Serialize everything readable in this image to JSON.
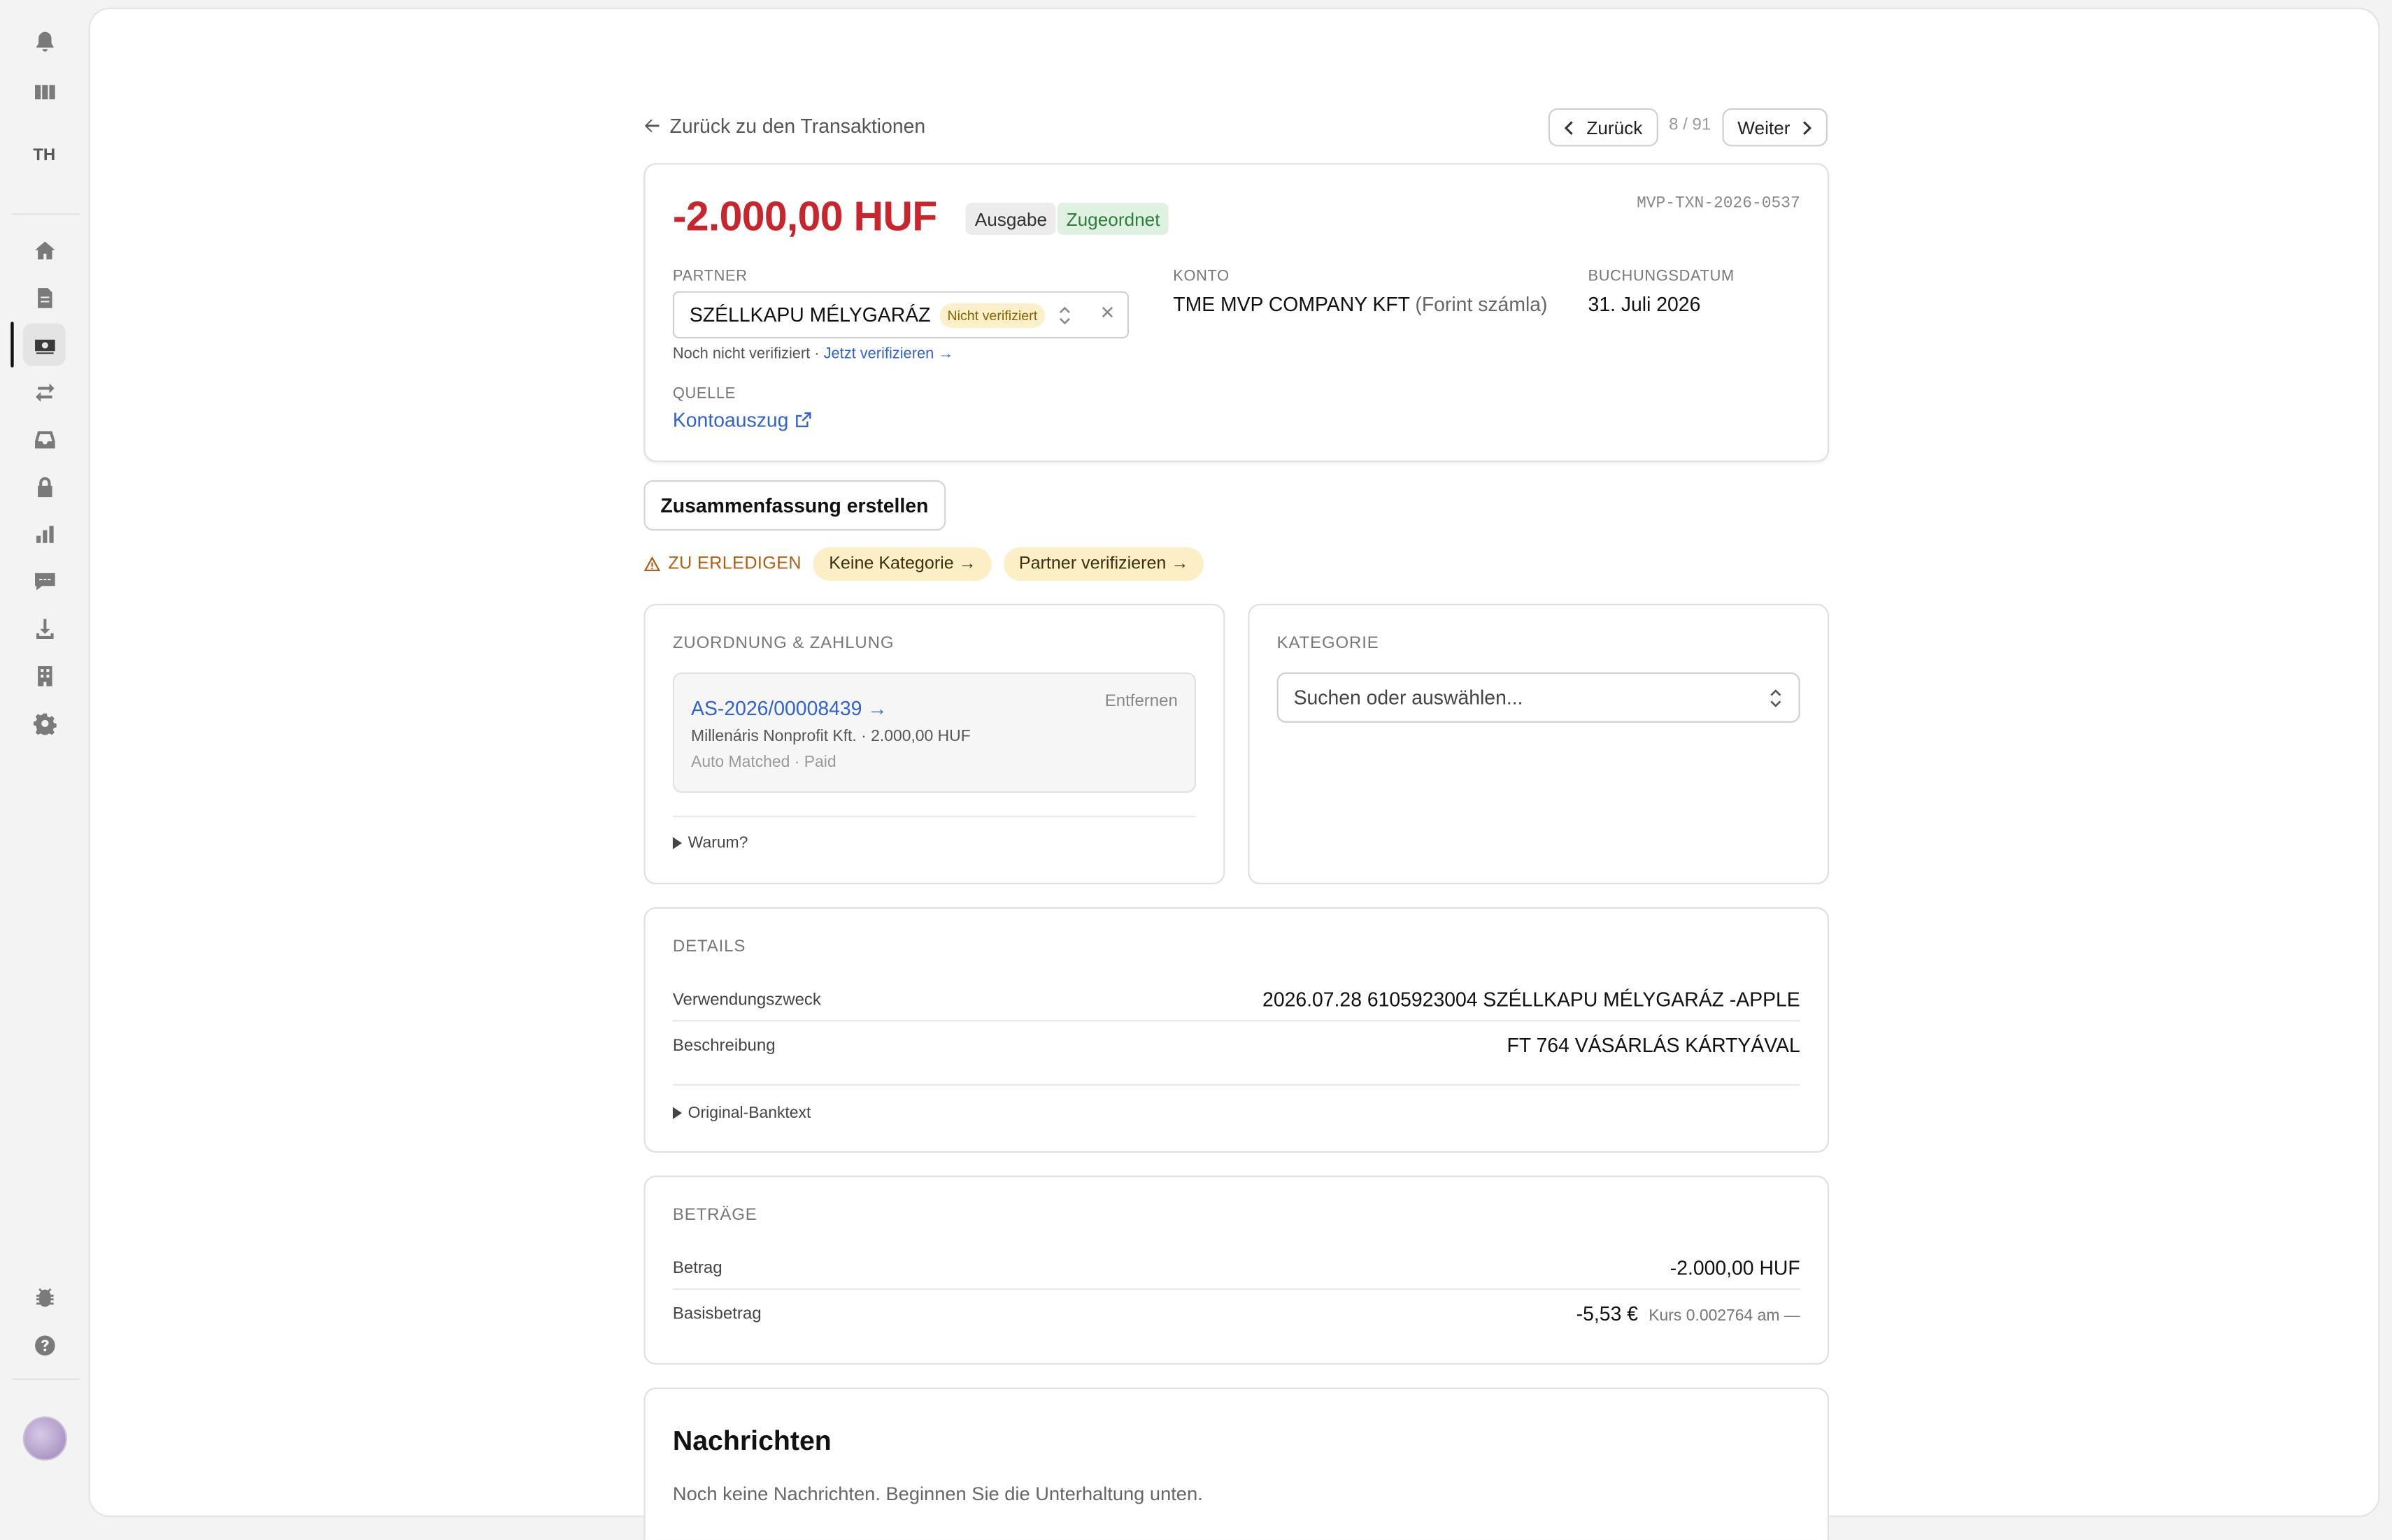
{
  "sidebar": {
    "initials": "TH",
    "icons": [
      "bell-icon",
      "columns-icon",
      "home-icon",
      "document-icon",
      "cash-icon",
      "transfer-icon",
      "inbox-icon",
      "lock-icon",
      "chart-icon",
      "chat-icon",
      "download-icon",
      "building-icon",
      "gear-icon",
      "bug-icon",
      "help-icon"
    ]
  },
  "nav": {
    "back_label": "Zurück zu den Transaktionen",
    "prev_label": "Zurück",
    "pager": "8 / 91",
    "next_label": "Weiter"
  },
  "transaction": {
    "amount": "-2.000,00 HUF",
    "badge_type": "Ausgabe",
    "badge_status": "Zugeordnet",
    "id": "MVP-TXN-2026-0537",
    "partner_label": "PARTNER",
    "partner_name": "SZÉLLKAPU MÉLYGARÁZ",
    "partner_pill": "Nicht verifiziert",
    "partner_hint": "Noch nicht verifiziert ·",
    "partner_verify_link": "Jetzt verifizieren →",
    "konto_label": "KONTO",
    "konto_name": "TME MVP COMPANY KFT",
    "konto_sub": "(Forint számla)",
    "date_label": "BUCHUNGSDATUM",
    "date_value": "31. Juli 2026",
    "source_label": "QUELLE",
    "source_link": "Kontoauszug",
    "amount_color": "#c9252c"
  },
  "actions": {
    "summary_button": "Zusammenfassung erstellen",
    "todo_label": "ZU ERLEDIGEN",
    "todo_chips": [
      "Keine Kategorie →",
      "Partner verifizieren →"
    ]
  },
  "zuordnung": {
    "title": "ZUORDNUNG & ZAHLUNG",
    "match_id": "AS-2026/00008439 →",
    "remove_label": "Entfernen",
    "match_line1": "Millenáris Nonprofit Kft. · 2.000,00 HUF",
    "match_line2": "Auto Matched · Paid",
    "why_toggle": "Warum?"
  },
  "kategorie": {
    "title": "KATEGORIE",
    "placeholder": "Suchen oder auswählen..."
  },
  "details": {
    "title": "DETAILS",
    "rows": [
      {
        "label": "Verwendungszweck",
        "value": "2026.07.28 6105923004 SZÉLLKAPU MÉLYGARÁZ -APPLE"
      },
      {
        "label": "Beschreibung",
        "value": "FT 764 VÁSÁRLÁS KÁRTYÁVAL"
      }
    ],
    "raw_toggle": "Original-Banktext"
  },
  "betraege": {
    "title": "BETRÄGE",
    "betrag_label": "Betrag",
    "betrag_value": "-2.000,00 HUF",
    "basis_label": "Basisbetrag",
    "basis_value": "-5,53 €",
    "basis_rate": "Kurs 0.002764 am —"
  },
  "nachrichten": {
    "title": "Nachrichten",
    "empty": "Noch keine Nachrichten. Beginnen Sie die Unterhaltung unten."
  }
}
